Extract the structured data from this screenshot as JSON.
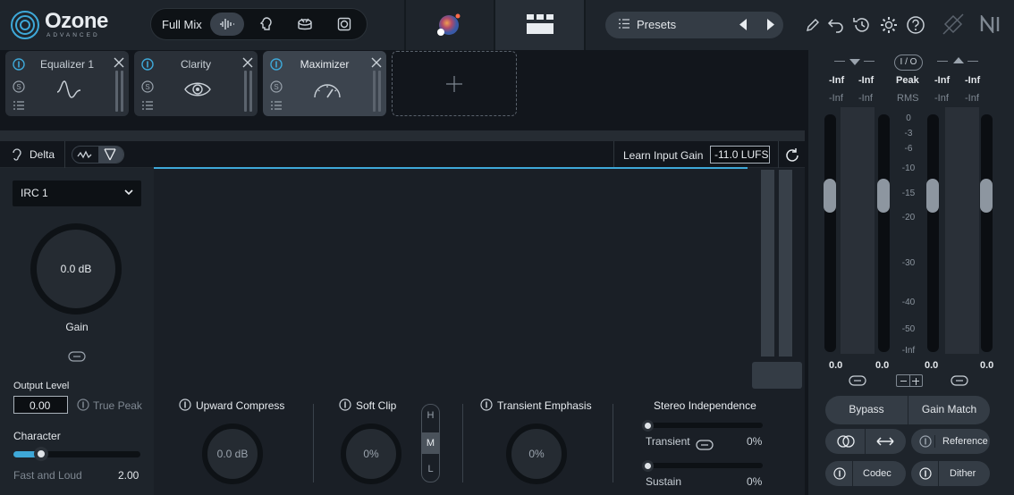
{
  "app": {
    "name": "Ozone",
    "edition": "ADVANCED"
  },
  "topbar": {
    "mix_label": "Full Mix",
    "presets_label": "Presets"
  },
  "modules": [
    {
      "name": "Equalizer 1"
    },
    {
      "name": "Clarity"
    },
    {
      "name": "Maximizer"
    }
  ],
  "toolrow": {
    "delta_label": "Delta",
    "learn_label": "Learn Input Gain",
    "lufs_value": "-11.0 LUFS"
  },
  "maximizer": {
    "mode": "IRC 1",
    "gain_value": "0.0 dB",
    "gain_label": "Gain",
    "output_level_label": "Output Level",
    "output_level_value": "0.00",
    "true_peak_label": "True Peak",
    "character_label": "Character",
    "character_mode": "Fast and Loud",
    "character_value": "2.00",
    "character_fraction": 0.22
  },
  "bottom": {
    "upward_title": "Upward Compress",
    "upward_value": "0.0 dB",
    "softclip_title": "Soft Clip",
    "softclip_value": "0%",
    "hml": [
      "H",
      "M",
      "L"
    ],
    "transient_title": "Transient Emphasis",
    "transient_value": "0%",
    "stereo_title": "Stereo Independence",
    "transient_label": "Transient",
    "transient_pct": "0%",
    "sustain_label": "Sustain",
    "sustain_pct": "0%"
  },
  "meters": {
    "in_left_peak": "-Inf",
    "in_right_peak": "-Inf",
    "in_left_rms": "-Inf",
    "in_right_rms": "-Inf",
    "out_left_peak": "-Inf",
    "out_right_peak": "-Inf",
    "out_left_rms": "-Inf",
    "out_right_rms": "-Inf",
    "io_label": "I / O",
    "peak_label": "Peak",
    "rms_label": "RMS",
    "scale": [
      "0",
      "-3",
      "-6",
      "-10",
      "-15",
      "-20",
      "-30",
      "-40",
      "-50",
      "-Inf"
    ],
    "fader_values": [
      "0.0",
      "0.0",
      "0.0",
      "0.0"
    ],
    "bypass_label": "Bypass",
    "gainmatch_label": "Gain Match",
    "reference_label": "Reference",
    "codec_label": "Codec",
    "dither_label": "Dither"
  },
  "colors": {
    "accent": "#3ea8d8",
    "panel": "#1e242b",
    "display": "#1a1f26"
  }
}
